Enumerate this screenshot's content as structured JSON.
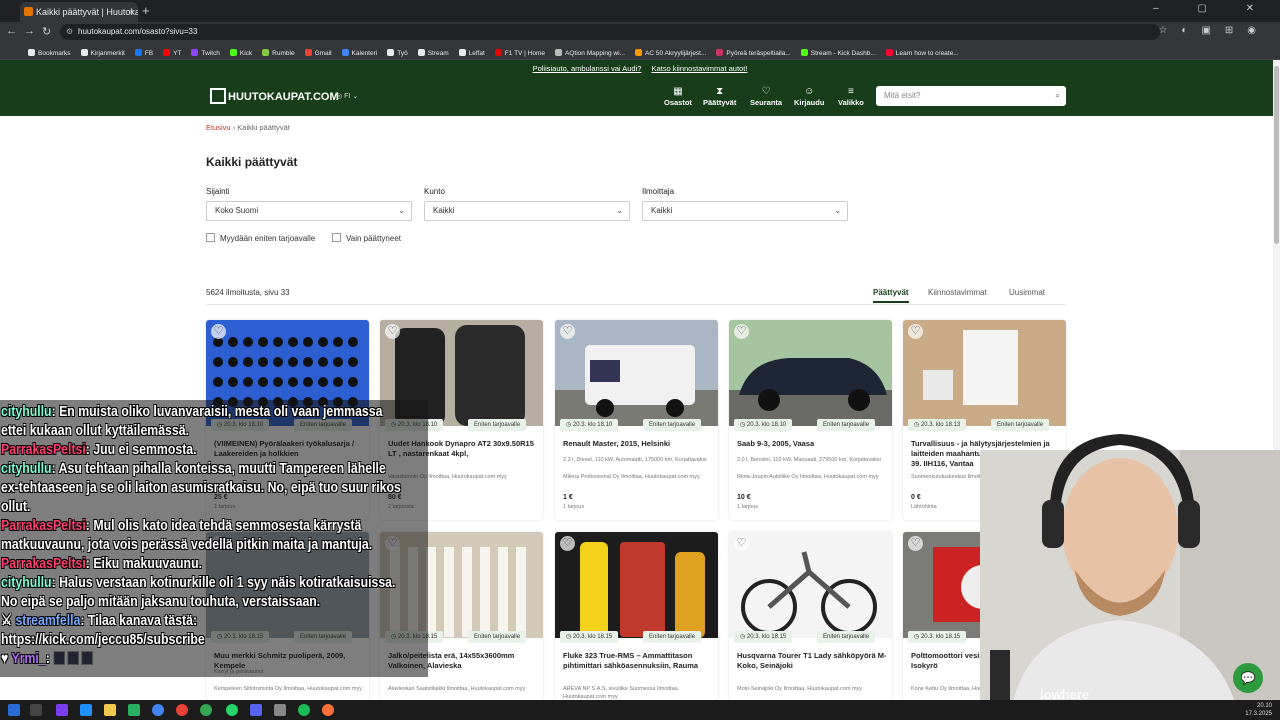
{
  "browser": {
    "tab_title": "Kaikki päättyvät | Huutokaupat",
    "tab_close": "×",
    "new_tab": "+",
    "url": "huutokaupat.com/osasto?sivu=33",
    "bookmarks": [
      {
        "label": "Bookmarks",
        "color": "#e8eaed"
      },
      {
        "label": "Kirjanmerkit",
        "color": "#e8eaed"
      },
      {
        "label": "FB",
        "color": "#1877f2"
      },
      {
        "label": "YT",
        "color": "#ff0000"
      },
      {
        "label": "Twitch",
        "color": "#9146ff"
      },
      {
        "label": "Kick",
        "color": "#53fc18"
      },
      {
        "label": "Rumble",
        "color": "#85c742"
      },
      {
        "label": "Gmail",
        "color": "#ea4335"
      },
      {
        "label": "Kalenteri",
        "color": "#4285f4"
      },
      {
        "label": "Työ",
        "color": "#e8eaed"
      },
      {
        "label": "Stream",
        "color": "#e8eaed"
      },
      {
        "label": "Leffat",
        "color": "#e8eaed"
      },
      {
        "label": "F1 TV | Home",
        "color": "#e10600"
      },
      {
        "label": "AQtion Mapping wi...",
        "color": "#bbbbbb"
      },
      {
        "label": "AC 50 Akryylijärjest...",
        "color": "#ff9900"
      },
      {
        "label": "Pyöreä teräspeltiaila...",
        "color": "#cc3366"
      },
      {
        "label": "Stream - Kick Dashb...",
        "color": "#53fc18"
      },
      {
        "label": "Learn how to create...",
        "color": "#ff0033"
      }
    ]
  },
  "promo": {
    "link1": "Poliisiauto, ambulanssi vai Audi?",
    "link2": "Katso kiinnostavimmat autot!"
  },
  "header": {
    "logo": "HUUTOKAUPAT.COM",
    "lang": "FI",
    "nav": [
      {
        "label": "Osastot",
        "icon": "▦"
      },
      {
        "label": "Päättyvät",
        "icon": "⧗"
      },
      {
        "label": "Seuranta",
        "icon": "♡"
      },
      {
        "label": "Kirjaudu",
        "icon": "☺"
      },
      {
        "label": "Valikko",
        "icon": "≡"
      }
    ],
    "search_placeholder": "Mitä etsit?"
  },
  "breadcrumb": {
    "home": "Etusivu",
    "current": "Kaikki päättyvät"
  },
  "page_title": "Kaikki päättyvät",
  "filters": {
    "sijainti": {
      "label": "Sijainti",
      "value": "Koko Suomi"
    },
    "kunto": {
      "label": "Kunto",
      "value": "Kaikki"
    },
    "ilmoittaja": {
      "label": "Ilmoittaja",
      "value": "Kaikki"
    }
  },
  "checkboxes": {
    "highest_bid": "Myydään eniten tarjoavalle",
    "only_ended": "Vain päättyneet"
  },
  "results": {
    "count": "5624 ilmoitusta, sivu 33",
    "sort_tabs": [
      "Päättyvät",
      "Kiinnostavimmat",
      "Uusimmat"
    ]
  },
  "cards": [
    {
      "time": "20.3. klo 18.10",
      "badge": "Eniten tarjoavalle",
      "title": "(VIIMEINEN) Pyörälaakeri työkalusarja / Laakereiden ja holkkien",
      "desc": "",
      "seller": "",
      "price": "25 €",
      "bids": "1 tarjous"
    },
    {
      "time": "20.3. klo 18.10",
      "badge": "Eniten tarjoavalle",
      "title": "Uudet Hankook Dynapro AT2 30x9.50R15 LT , nastarenkaat 4kpl,",
      "desc": "",
      "seller": "Varastoinnin Oy Ilmoittaa, Huutokaupat.com myy",
      "price": "80 €",
      "bids": "2 tarjousta"
    },
    {
      "time": "20.3. klo 18.10",
      "badge": "Eniten tarjoavalle",
      "title": "Renault Master, 2015, Helsinki",
      "desc": "2.3 l, Diesel, 110 kW, Automaatti, 175000 km, Korjattavaksi",
      "seller": "Milena Professional Oy Ilmoittaa, Huutokaupat.com myy",
      "price": "1 €",
      "bids": "1 tarjous"
    },
    {
      "time": "20.3. klo 18.10",
      "badge": "Eniten tarjoavalle",
      "title": "Saab 9-3, 2005, Vaasa",
      "desc": "2.0 l, Bensiini, 110 kW, Manuaali, 279500 km, Korjattavaksi",
      "seller": "Rinta-Joupin Autoliike Oy Ilmoittaa, Huutokaupat.com myy",
      "price": "10 €",
      "bids": "1 tarjous"
    },
    {
      "time": "20.3. klo 18.13",
      "badge": "Eniten tarjoavalle",
      "title": "Turvallisuus - ja hälytysjärjestelmien ja laitteiden maahantuojan inventaario erä 39. IIH116, Vantaa",
      "desc": "",
      "seller": "Suomenkulutuskeskus Ilmoittaa, Huutokaupat.com myy",
      "price": "0 €",
      "bids": "Lähtöhinta"
    },
    {
      "time": "20.3. klo 18.15",
      "badge": "Eniten tarjoavalle",
      "title": "Muu merkki Schmitz puoliperä, 2009, Kempele",
      "desc": "Kärryt ja perävaunut",
      "seller": "Kempeleen Siltotoiminta Oy Ilmoittaa, Huutokaupat.com myy",
      "price": "",
      "bids": ""
    },
    {
      "time": "20.3. klo 18.15",
      "badge": "Eniten tarjoavalle",
      "title": "Jalko/peitelista erä, 14x55x3600mm Valkoinen, Alavieska",
      "desc": "",
      "seller": "Alavieskan Saatstilaikki Ilmoittaa, Huutokaupat.com myy",
      "price": "",
      "bids": ""
    },
    {
      "time": "20.3. klo 18.15",
      "badge": "Eniten tarjoavalle",
      "title": "Fluke 323 True-RMS – Ammattitason pihtimittari sähköasennuksiin, Rauma",
      "desc": "",
      "seller": "AREVA NP S.A.S, sivuliike Suomessa Ilmoittaa, Huutokaupat.com myy",
      "price": "",
      "bids": ""
    },
    {
      "time": "20.3. klo 18.15",
      "badge": "Eniten tarjoavalle",
      "title": "Husqvarna Tourer T1 Lady sähköpyörä M-Koko, Seinäjoki",
      "desc": "",
      "seller": "Moto-Seinäjoki Oy Ilmoittaa, Huutokaupat.com myy",
      "price": "",
      "bids": ""
    },
    {
      "time": "20.3. klo 18.15",
      "badge": "Eniten tarjoavalle",
      "title": "Polttomoottori vesipumppu 600L/MIN, Isokyrö",
      "desc": "",
      "seller": "Kone Kettu Oy Ilmoittaa, Huutokaupat.com myy",
      "price": "",
      "bids": ""
    }
  ],
  "chat": [
    {
      "user": "cityhullu",
      "color": "#7fffd4",
      "text": ": En muista oliko luvanvaraisii, mesta oli vaan jemmassa",
      "cont": "ettei kukaan ollut kyttäilemässä."
    },
    {
      "user": "ParrakasPeltsi",
      "color": "#ff4070",
      "text": ": Juu ei semmosta.",
      "cont": ""
    },
    {
      "user": "cityhullu",
      "color": "#7fffd4",
      "text": ": Asu tehtaan pihalla konteissa, muutti Tampereen lähelle",
      "cont": "ex-tehtaaseen ja se oli laiton asumisratkaisu. No, eipä tuo suur rikos",
      "cont2": "ollut."
    },
    {
      "user": "ParrakasPeltsi",
      "color": "#ff4070",
      "text": ": Mul olis kato idea tehdä semmosesta kärrystä",
      "cont": "matkuuvaunu, jota vois perässä vedellä pitkin maita ja mantuja."
    },
    {
      "user": "ParrakasPeltsi",
      "color": "#ff4070",
      "text": ": Eiku makuuvaunu.",
      "cont": ""
    },
    {
      "user": "cityhullu",
      "color": "#7fffd4",
      "text": ": Halus verstaan kotinurkille oli 1 syy näis kotiratkaisuissa.",
      "cont": "No eipä se paljo mitään jaksanu touhuta, verstaissaan."
    },
    {
      "user": "streamfella",
      "color": "#7aa8ff",
      "text": ": Tilaa kanava tästä:",
      "cont": "https://kick.com/jeccu85/subscribe"
    },
    {
      "user": "Yrmi_",
      "color": "#b56cff",
      "text": ":",
      "cont": ""
    }
  ],
  "overlay": {
    "watermark": "lowhere"
  },
  "taskbar": {
    "time": "20.10",
    "date": "17.3.2025"
  }
}
